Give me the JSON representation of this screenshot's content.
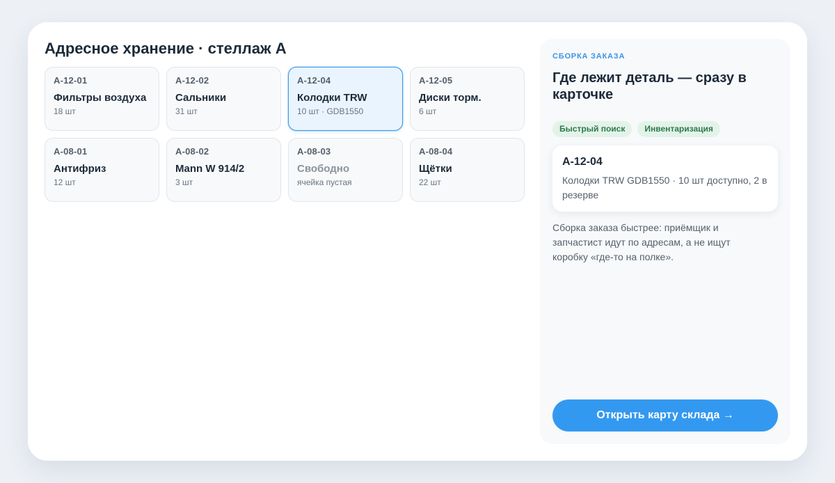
{
  "main": {
    "title": "Адресное хранение · стеллаж A",
    "cells": [
      {
        "code": "A-12-01",
        "name": "Фильтры воздуха",
        "qty": "18 шт"
      },
      {
        "code": "A-12-02",
        "name": "Сальники",
        "qty": "31 шт"
      },
      {
        "code": "A-12-04",
        "name": "Колодки TRW",
        "qty": "10 шт · GDB1550"
      },
      {
        "code": "A-12-05",
        "name": "Диски торм.",
        "qty": "6 шт"
      },
      {
        "code": "A-08-01",
        "name": "Антифриз",
        "qty": "12 шт"
      },
      {
        "code": "A-08-02",
        "name": "Mann W 914/2",
        "qty": "3 шт"
      },
      {
        "code": "A-08-03",
        "name": "Свободно",
        "qty": "ячейка пустая"
      },
      {
        "code": "A-08-04",
        "name": "Щётки",
        "qty": "22 шт"
      }
    ]
  },
  "panel": {
    "eyebrow": "СБОРКА ЗАКАЗА",
    "title": "Где лежит деталь — сразу в карточке",
    "tags": [
      "Быстрый поиск",
      "Инвентаризация"
    ],
    "info": {
      "code": "A-12-04",
      "desc": "Колодки TRW GDB1550 · 10 шт доступно, 2 в резерве"
    },
    "note": "Сборка заказа быстрее: приёмщик и запчастист идут по адресам, а не ищут коробку «где-то на полке».",
    "cta": "Открыть карту склада →"
  }
}
